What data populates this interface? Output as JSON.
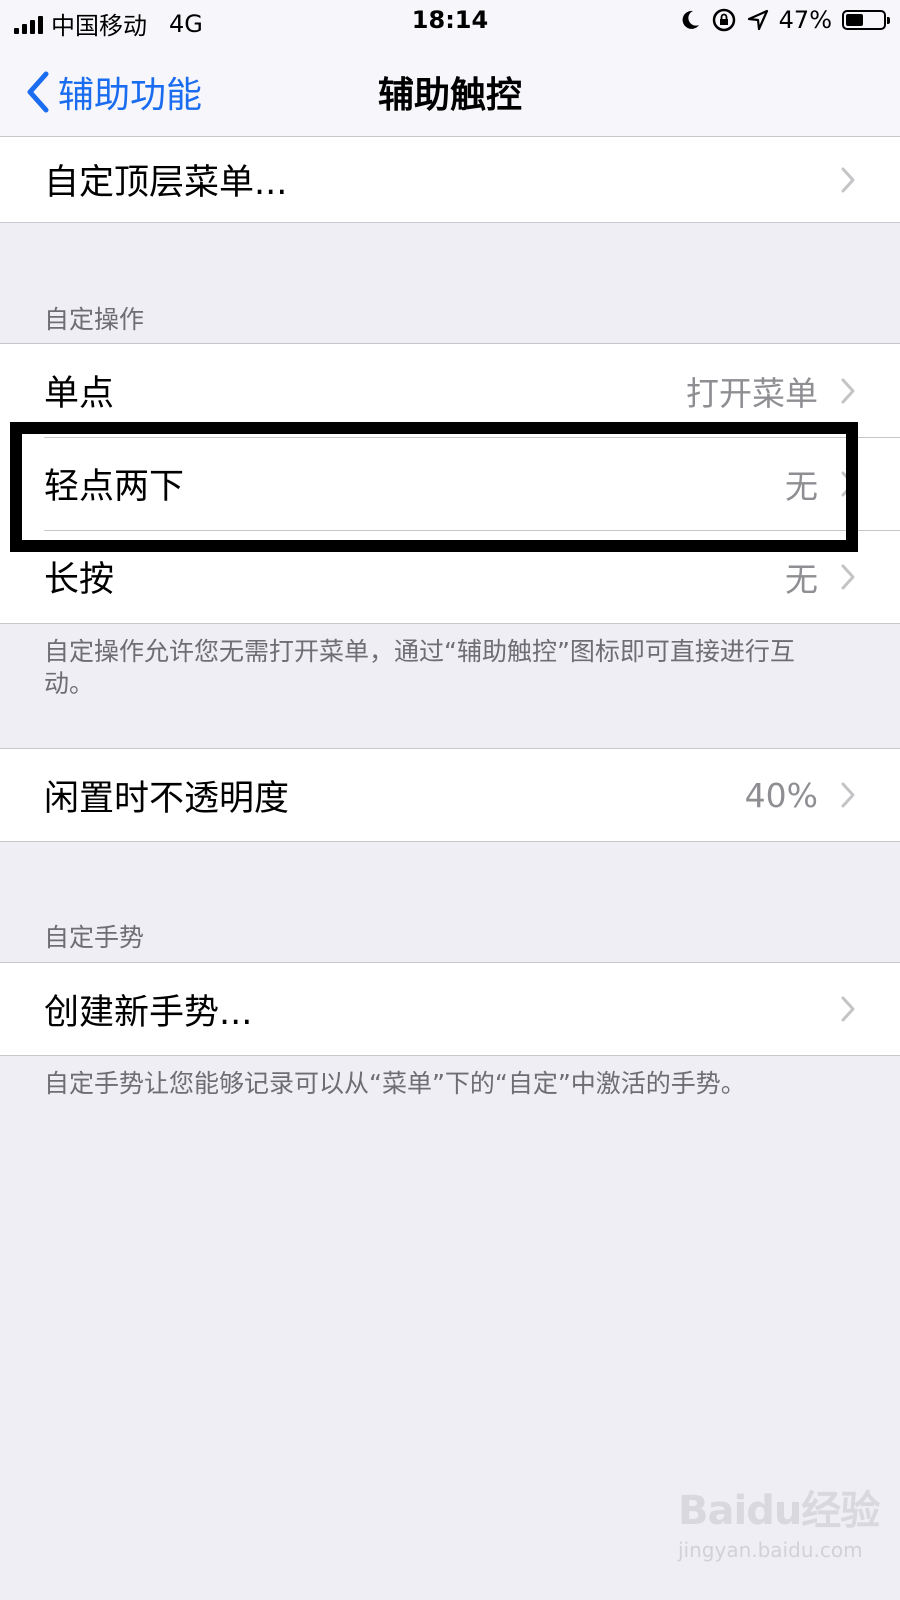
{
  "status_bar": {
    "carrier": "中国移动",
    "network": "4G",
    "time": "18:14",
    "battery_percent": "47%",
    "battery_level": 0.47,
    "icons": [
      "signal-icon",
      "moon-icon",
      "rotation-lock-icon",
      "location-icon",
      "battery-icon"
    ]
  },
  "nav": {
    "back_label": "辅助功能",
    "title": "辅助触控"
  },
  "top_menu": {
    "label": "自定顶层菜单..."
  },
  "custom_actions": {
    "header": "自定操作",
    "rows": [
      {
        "label": "单点",
        "value": "打开菜单"
      },
      {
        "label": "轻点两下",
        "value": "无"
      },
      {
        "label": "长按",
        "value": "无"
      }
    ],
    "footer": "自定操作允许您无需打开菜单，通过“辅助触控”图标即可直接进行互动。"
  },
  "idle_opacity": {
    "label": "闲置时不透明度",
    "value": "40%"
  },
  "custom_gestures": {
    "header": "自定手势",
    "create_label": "创建新手势...",
    "footer": "自定手势让您能够记录可以从“菜单”下的“自定”中激活的手势。"
  },
  "watermark": {
    "logo": "Baidu经验",
    "url": "jingyan.baidu.com"
  },
  "colors": {
    "accent": "#1a6cf0",
    "background": "#efeef4",
    "secondary_text": "#8e8e93",
    "separator": "#c8c7cc",
    "highlight_border": "#000000"
  }
}
